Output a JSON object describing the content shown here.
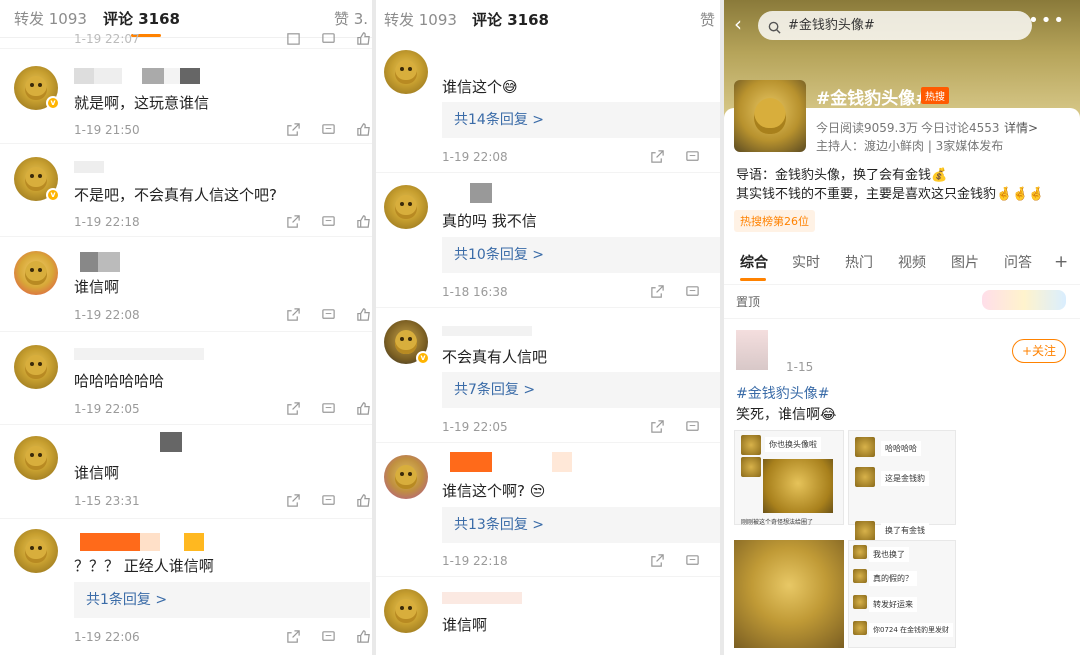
{
  "panel1": {
    "tabs": {
      "repost": "转发 1093",
      "comments": "评论 3168",
      "likes": "赞 3."
    },
    "top_time": "1-19 22:07",
    "comments": [
      {
        "text": "就是啊，这玩意谁信",
        "time": "1-19 21:50"
      },
      {
        "text": "不是吧，不会真有人信这个吧?",
        "time": "1-19 22:18"
      },
      {
        "text": "谁信啊",
        "time": "1-19 22:08"
      },
      {
        "text": "哈哈哈哈哈哈",
        "time": "1-19 22:05"
      },
      {
        "text": "谁信啊",
        "time": "1-15 23:31"
      },
      {
        "text": "？？？ 正经人谁信啊",
        "time": "1-19 22:06",
        "reply": "共1条回复 >"
      }
    ]
  },
  "panel2": {
    "tabs": {
      "repost": "转发 1093",
      "comments": "评论 3168",
      "likes": "赞"
    },
    "comments": [
      {
        "text": "谁信这个😅",
        "reply": "共14条回复 >",
        "time": "1-19 22:08"
      },
      {
        "text": "真的吗 我不信",
        "reply": "共10条回复 >",
        "time": "1-18 16:38"
      },
      {
        "text": "不会真有人信吧",
        "reply": "共7条回复 >",
        "time": "1-19 22:05"
      },
      {
        "text": "谁信这个啊? 😒",
        "reply": "共13条回复 >",
        "time": "1-19 22:18"
      },
      {
        "text": "谁信啊"
      }
    ]
  },
  "panel3": {
    "search": "#金钱豹头像#",
    "topic_title": "#金钱豹头像#",
    "hot_badge": "热搜",
    "reads": "今日阅读9059.3万",
    "discuss": "今日讨论4553",
    "details": "详情>",
    "host": "主持人：渡边小鲜肉 | 3家媒体发布",
    "intro1": "导语：金钱豹头像，换了会有金钱💰",
    "intro2": "其实钱不钱的不重要，主要是喜欢这只金钱豹🤞🤞🤞",
    "rank": "热搜榜第26位",
    "nav": [
      "综合",
      "实时",
      "热门",
      "视频",
      "图片",
      "问答",
      "+"
    ],
    "pinned": "置顶",
    "post_time": "1-15",
    "follow": "+关注",
    "post_tag": "#金钱豹头像#",
    "post_text": "笑死，谁信啊😂",
    "chat1": {
      "top": "你也换头像啦",
      "bottom": "刚刚被这个奇怪想法给圈了"
    },
    "chat2": {
      "a": "哈哈哈哈",
      "b": "这是金钱豹",
      "c": "换了有金钱"
    },
    "chat3": [
      "我也换了",
      "真的假的？",
      "转发好运来",
      "你0724 在金钱豹里发财"
    ]
  },
  "colors": {
    "accent": "#ff8200",
    "link": "#3b6ca8",
    "hot": "#ff5a00"
  }
}
